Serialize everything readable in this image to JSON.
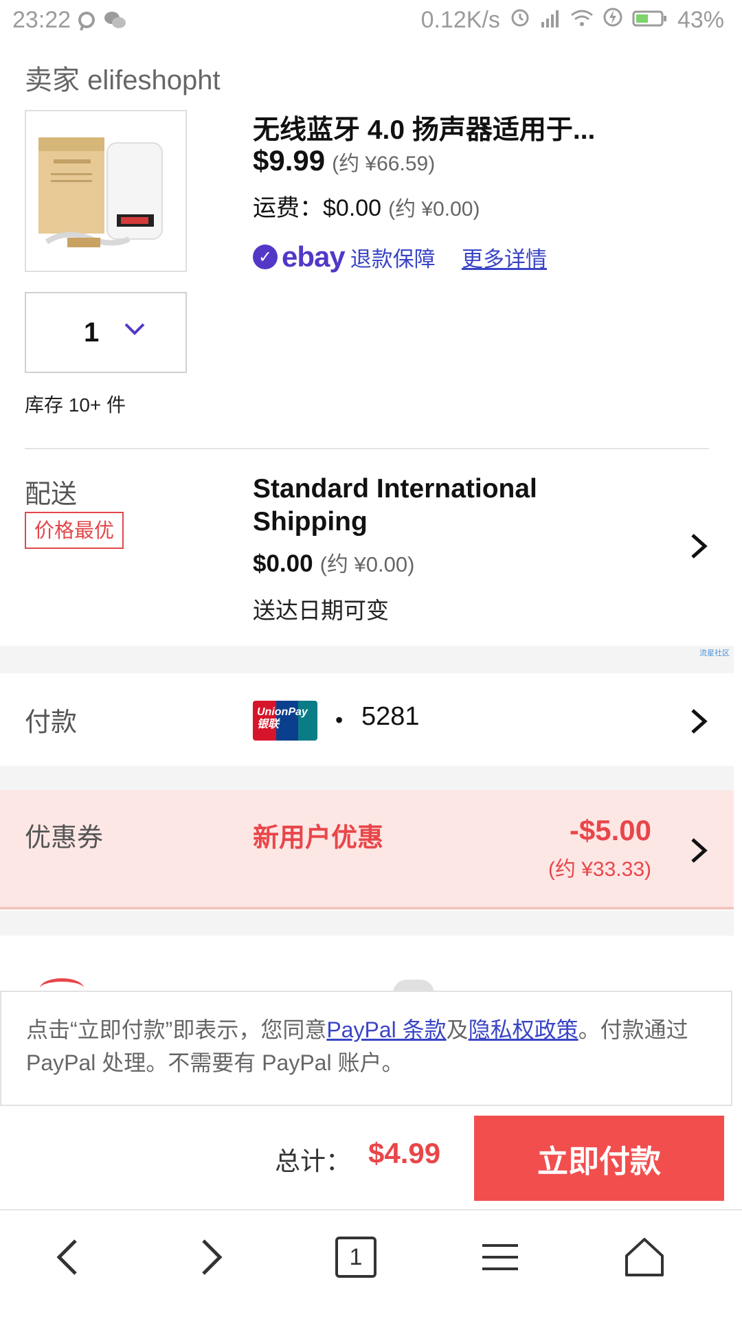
{
  "status_bar": {
    "time": "23:22",
    "network_speed": "0.12K/s",
    "battery": "43%",
    "icons": [
      "chat-icon",
      "wechat-icon",
      "alarm-icon",
      "signal-icon",
      "wifi-icon",
      "charge-icon",
      "battery-icon"
    ]
  },
  "seller": {
    "label": "卖家 elifeshopht"
  },
  "item": {
    "title": "无线蓝牙 4.0 扬声器适用于...",
    "price": "$9.99",
    "price_approx": "(约 ¥66.59)",
    "shipping_label": "运费：$0.00",
    "shipping_approx": "(约 ¥0.00)",
    "guarantee_logo": "ebay",
    "guarantee_text": "退款保障",
    "more_details": "更多详情",
    "quantity": "1",
    "stock": "库存 10+ 件"
  },
  "delivery": {
    "label": "配送",
    "badge": "价格最优",
    "method": "Standard International Shipping",
    "price": "$0.00",
    "price_approx": "(约 ¥0.00)",
    "note": "送达日期可变"
  },
  "watermark": "流星社区",
  "payment": {
    "label": "付款",
    "card_brand": "UnionPay 银联",
    "bullet": "•",
    "card_last4": "5281"
  },
  "coupon": {
    "label": "优惠券",
    "name": "新用户优惠",
    "amount": "-$5.00",
    "amount_approx": "(约 ¥33.33)"
  },
  "terms": {
    "prefix": "点击“立即付款”即表示，您同意",
    "paypal_terms": "PayPal 条款",
    "and": "及",
    "privacy": "隐私权政策",
    "suffix": "。付款通过 PayPal 处理。不需要有 PayPal 账户。"
  },
  "checkout": {
    "total_label": "总计：",
    "total_value": "$4.99",
    "pay_button": "立即付款"
  },
  "browser_nav": {
    "tab_count": "1"
  },
  "colors": {
    "accent_red": "#f24e4e",
    "ebay_purple": "#5338c7",
    "link_blue": "#3a45c6",
    "coupon_bg": "#fde7e5"
  }
}
